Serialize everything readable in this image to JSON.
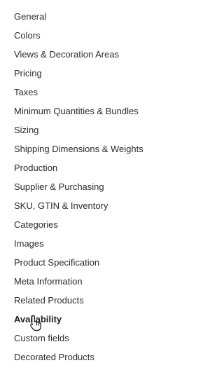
{
  "menu": {
    "items": [
      {
        "label": "General"
      },
      {
        "label": "Colors"
      },
      {
        "label": "Views & Decoration Areas"
      },
      {
        "label": "Pricing"
      },
      {
        "label": "Taxes"
      },
      {
        "label": "Minimum Quantities & Bundles"
      },
      {
        "label": "Sizing"
      },
      {
        "label": "Shipping Dimensions & Weights"
      },
      {
        "label": "Production"
      },
      {
        "label": "Supplier & Purchasing"
      },
      {
        "label": "SKU, GTIN & Inventory"
      },
      {
        "label": "Categories"
      },
      {
        "label": "Images"
      },
      {
        "label": "Product Specification"
      },
      {
        "label": "Meta Information"
      },
      {
        "label": "Related Products"
      },
      {
        "label": "Availability"
      },
      {
        "label": "Custom fields"
      },
      {
        "label": "Decorated Products"
      }
    ]
  },
  "cursor": {
    "icon": "hand-pointer-icon"
  }
}
